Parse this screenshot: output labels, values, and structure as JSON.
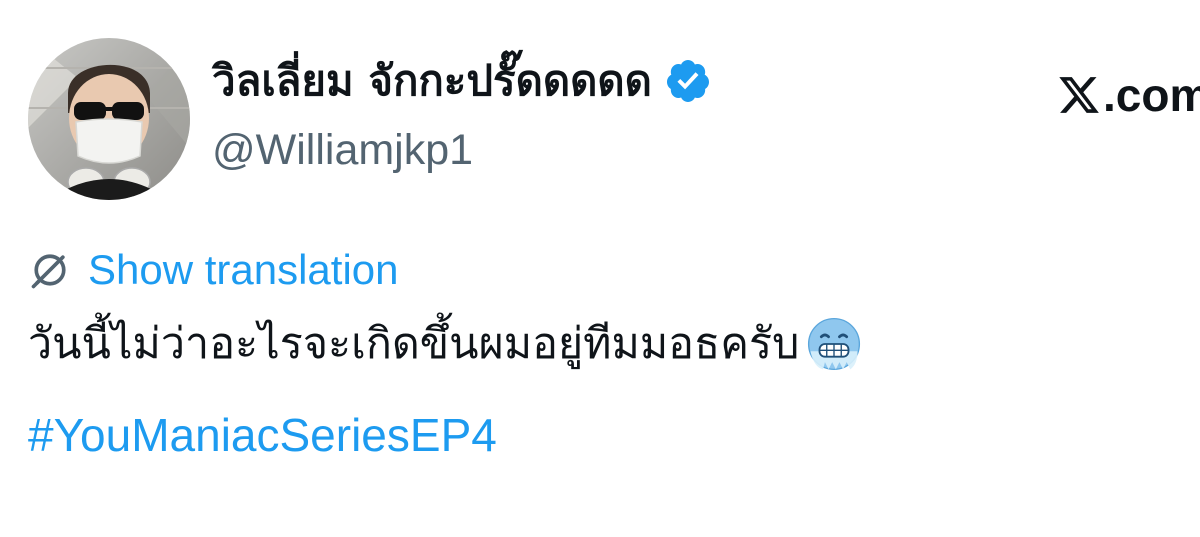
{
  "brand": {
    "text": ".com",
    "icon": "x-logo-icon"
  },
  "author": {
    "display_name": "วิลเลี่ยม จักกะปรั๊ดดดดด",
    "handle": "@Williamjkp1",
    "verified_icon": "verified-badge-icon",
    "avatar_icon": "avatar-photo"
  },
  "translate": {
    "icon": "globe-icon",
    "label": "Show translation"
  },
  "tweet": {
    "text": "วันนี้ไม่ว่าอะไรจะเกิดขึ้นผมอยู่ทีมมอธครับ",
    "emoji": "cold-face-emoji",
    "hashtag": "#YouManiacSeriesEP4"
  },
  "colors": {
    "link": "#1d9bf0",
    "text": "#0f1419",
    "secondary": "#536471",
    "verified": "#1d9bf0"
  }
}
